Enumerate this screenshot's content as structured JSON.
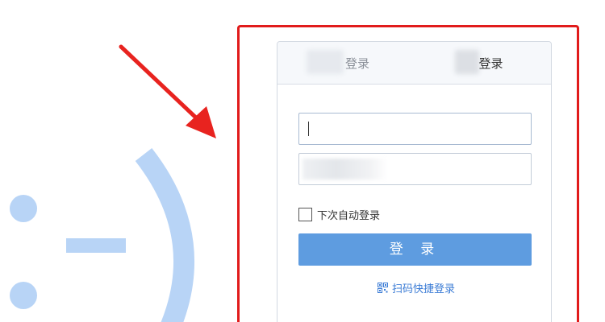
{
  "tabs": [
    {
      "label": "登录"
    },
    {
      "label": "登录"
    }
  ],
  "login": {
    "username_value": "",
    "password_value": "",
    "remember_label": "下次自动登录",
    "button_label": "登 录",
    "qr_label": "扫码快捷登录"
  },
  "icons": {
    "qr": "qr-code-icon",
    "arrow": "red-arrow",
    "smiley": "smiley-emoticon"
  },
  "colors": {
    "highlight": "#e11b1b",
    "button": "#5e9ce0",
    "link": "#3a7bd5",
    "smiley": "#b8d4f6"
  }
}
